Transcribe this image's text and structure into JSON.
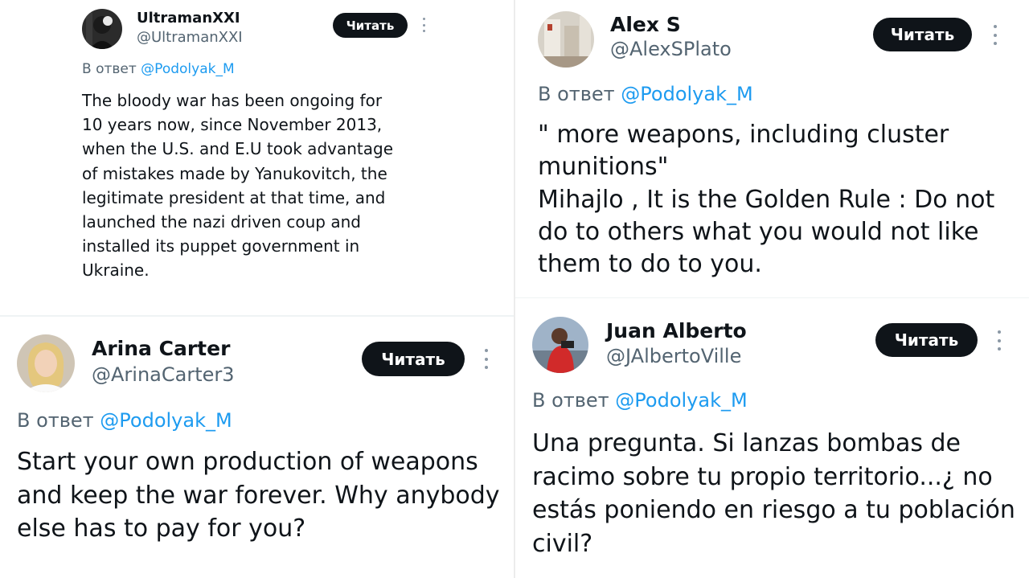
{
  "button_label": "Читать",
  "reply_prefix": "В ответ",
  "colors": {
    "button_bg": "#0f1419",
    "mention": "#1d9bf0",
    "secondary_text": "#536471"
  },
  "icons": {
    "more": "more-vertical-icon"
  },
  "tweets": [
    {
      "name": "UltramanXXI",
      "handle": "@UltramanXXI",
      "reply_to": "@Podolyak_M",
      "text": "The bloody war has been ongoing for\n10 years now, since November 2013,\nwhen the U.S. and E.U took advantage\nof mistakes made by Yanukovitch, the\nlegitimate president at that time, and\nlaunched the nazi driven coup and\ninstalled its puppet government in\nUkraine."
    },
    {
      "name": "Arina Carter",
      "handle": "@ArinaCarter3",
      "reply_to": "@Podolyak_M",
      "text": "Start your own production of weapons\nand keep the war forever. Why anybody\nelse has to pay for you?"
    },
    {
      "name": "Alex S",
      "handle": "@AlexSPlato",
      "reply_to": "@Podolyak_M",
      "text": "\" more weapons, including cluster\nmunitions\"\nMihajlo , It  is   the  Golden  Rule : Do not\ndo to others what you would not like\nthem to do to you."
    },
    {
      "name": "Juan Alberto",
      "handle": "@JAlbertoVille",
      "reply_to": "@Podolyak_M",
      "text": "Una pregunta. Si lanzas bombas de\nracimo sobre tu propio territorio...¿ no\nestás poniendo en riesgo a tu población\ncivil?"
    }
  ]
}
